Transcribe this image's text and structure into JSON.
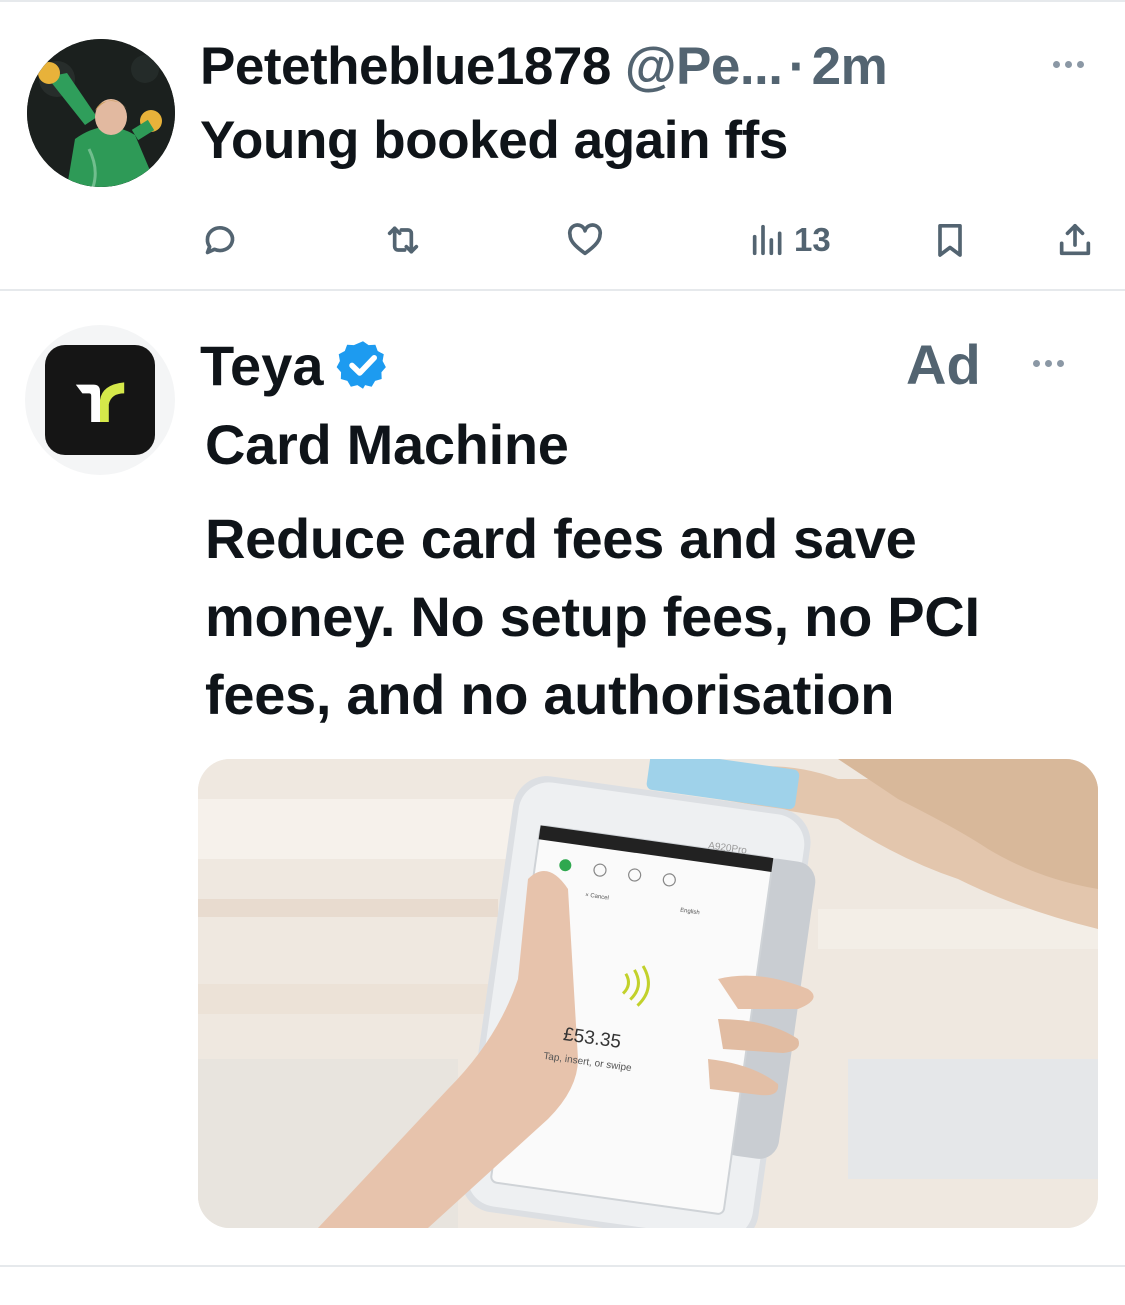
{
  "colors": {
    "text_primary": "#0f1419",
    "text_secondary": "#536471",
    "verified_blue": "#1d9bf0",
    "teya_logo_green": "#d5e84a",
    "divider": "#e6e9ec"
  },
  "tweet1": {
    "display_name": "Petetheblue1878",
    "handle": "@Pe...",
    "separator": "·",
    "time": "2m",
    "text": "Young booked again ffs",
    "actions": {
      "reply_icon": "reply-bubble-icon",
      "retweet_icon": "retweet-icon",
      "like_icon": "heart-icon",
      "views_icon": "views-bar-chart-icon",
      "views_count": "13",
      "bookmark_icon": "bookmark-icon",
      "share_icon": "share-upload-icon"
    }
  },
  "ad_tweet": {
    "display_name": "Teya",
    "verified": true,
    "ad_label": "Ad",
    "title": "Card Machine",
    "body": "Reduce card fees and save money. No setup fees, no PCI fees, and no authorisation",
    "media": {
      "screen_amount": "£53.35",
      "screen_hint": "Tap, insert, or swipe",
      "device_model": "A920Pro",
      "screen_cancel": "× Cancel",
      "screen_language": "English"
    }
  }
}
